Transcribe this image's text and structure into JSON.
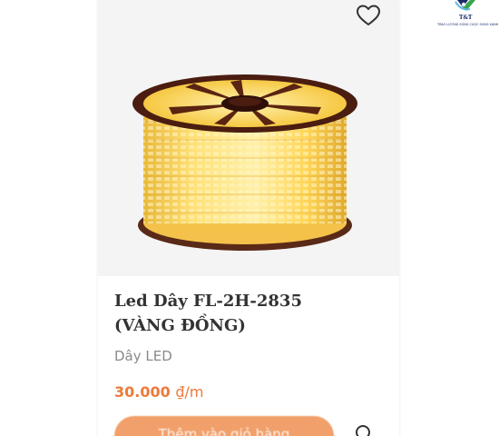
{
  "product": {
    "name": "Led Dây FL-2H-2835 (VÀNG ĐỒNG)",
    "category": "Dây LED",
    "price": "30.000",
    "price_unit": "₫/m",
    "add_to_cart_label": "Thêm vào giỏ hàng"
  },
  "brand": {
    "name": "T&T",
    "tagline": "TRAO LƯƠNG SỐNG CUỘC SỐNG XANH"
  },
  "icons": {
    "wishlist": "heart-outline-icon",
    "quick_view": "search-icon"
  },
  "colors": {
    "accent": "#ed7a3a",
    "button": "#f2a06b",
    "image_background": "#f4f4f4",
    "led_glow": "#ffd84a",
    "brand_blue": "#1b2a6b",
    "brand_green": "#3aa54a"
  }
}
